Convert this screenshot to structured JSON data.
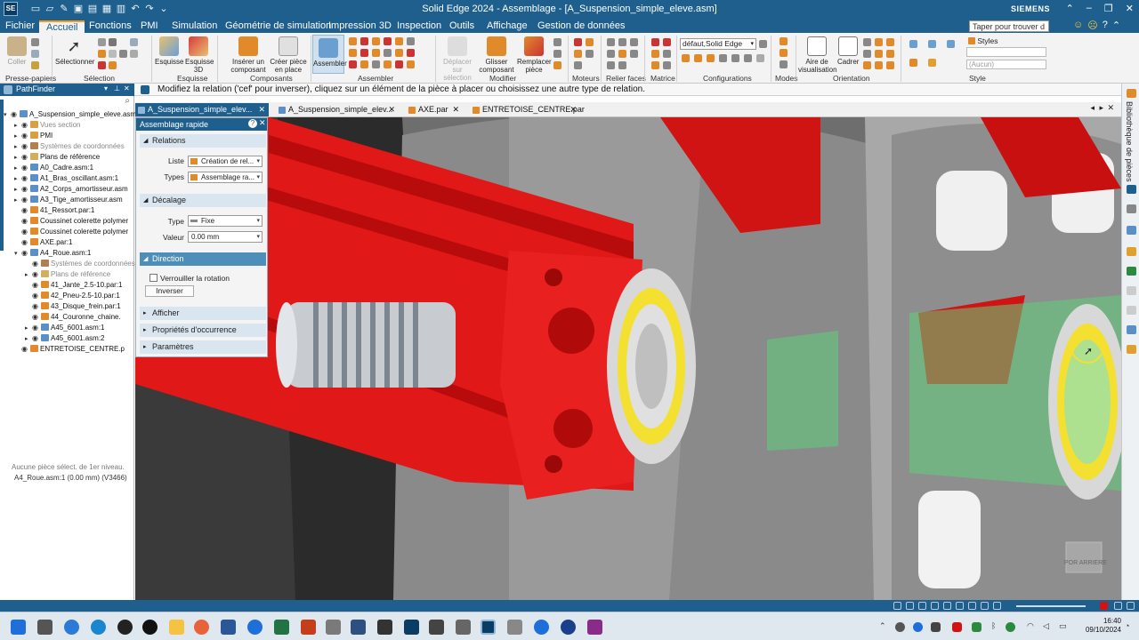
{
  "titlebar": {
    "app_logo": "SE",
    "title": "Solid Edge 2024 - Assemblage - [A_Suspension_simple_eleve.asm]",
    "brand": "SIEMENS"
  },
  "menu": {
    "tabs": [
      "Fichier",
      "Accueil",
      "Fonctions",
      "PMI",
      "Simulation",
      "Géométrie de simulation",
      "Impression 3D",
      "Inspection",
      "Outils",
      "Affichage",
      "Gestion de données"
    ],
    "active_tab": "Accueil",
    "search_placeholder": "Taper pour trouver d"
  },
  "ribbon": {
    "buttons": {
      "coller": "Coller",
      "selectionner": "Sélectionner",
      "esquisse": "Esquisse",
      "esquisse3d": "Esquisse 3D",
      "inserer": "Insérer un composant",
      "creer": "Créer pièce en place",
      "assembler": "Assembler",
      "deplacer": "Déplacer sur sélection",
      "glisser": "Glisser composant",
      "remplacer": "Remplacer pièce",
      "aire": "Aire de visualisation",
      "cadrer": "Cadrer"
    },
    "config_value": "défaut,Solid Edge",
    "styles_label": "Styles",
    "style_value": "(Aucun)",
    "groups": {
      "presse": "Presse-papiers",
      "selection": "Sélection",
      "esquisse": "Esquisse",
      "composants": "Composants",
      "assembler": "Assembler",
      "modifier": "Modifier",
      "moteurs": "Moteurs",
      "relier": "Relier faces",
      "matrice": "Matrice",
      "configurations": "Configurations",
      "modes": "Modes",
      "orientation": "Orientation",
      "style": "Style"
    }
  },
  "prompt": {
    "pathfinder_title": "PathFinder",
    "message": "Modifiez la relation ('cef' pour inverser), cliquez sur un élément de la pièce à placer ou choisissez une autre type de relation."
  },
  "tree": [
    {
      "label": "A_Suspension_simple_eleve.asm",
      "level": 0,
      "exp": "▾",
      "color": "#5b8fc7",
      "dim": false
    },
    {
      "label": "Vues section",
      "level": 1,
      "exp": "▸",
      "color": "#d8a040",
      "dim": true
    },
    {
      "label": "PMI",
      "level": 1,
      "exp": "▸",
      "color": "#d8a040",
      "dim": false
    },
    {
      "label": "Systèmes de coordonnées",
      "level": 1,
      "exp": "▸",
      "color": "#b08050",
      "dim": true
    },
    {
      "label": "Plans de référence",
      "level": 1,
      "exp": "▸",
      "color": "#d0b060",
      "dim": false
    },
    {
      "label": "A0_Cadre.asm:1",
      "level": 1,
      "exp": "▸",
      "color": "#5b8fc7",
      "dim": false
    },
    {
      "label": "A1_Bras_oscillant.asm:1",
      "level": 1,
      "exp": "▸",
      "color": "#5b8fc7",
      "dim": false
    },
    {
      "label": "A2_Corps_amortisseur.asm",
      "level": 1,
      "exp": "▸",
      "color": "#5b8fc7",
      "dim": false
    },
    {
      "label": "A3_Tige_amortisseur.asm",
      "level": 1,
      "exp": "▸",
      "color": "#5b8fc7",
      "dim": false
    },
    {
      "label": "41_Ressort.par:1",
      "level": 1,
      "exp": "",
      "color": "#e08a2a",
      "dim": false
    },
    {
      "label": "Coussinet colerette polymer",
      "level": 1,
      "exp": "",
      "color": "#e08a2a",
      "dim": false
    },
    {
      "label": "Coussinet colerette polymer",
      "level": 1,
      "exp": "",
      "color": "#e08a2a",
      "dim": false
    },
    {
      "label": "AXE.par:1",
      "level": 1,
      "exp": "",
      "color": "#e08a2a",
      "dim": false
    },
    {
      "label": "A4_Roue.asm:1",
      "level": 1,
      "exp": "▾",
      "color": "#5b8fc7",
      "dim": false
    },
    {
      "label": "Systèmes de coordonnées",
      "level": 2,
      "exp": "",
      "color": "#b08050",
      "dim": true
    },
    {
      "label": "Plans de référence",
      "level": 2,
      "exp": "▸",
      "color": "#d0b060",
      "dim": true
    },
    {
      "label": "41_Jante_2.5-10.par:1",
      "level": 2,
      "exp": "",
      "color": "#e08a2a",
      "dim": false
    },
    {
      "label": "42_Pneu-2.5-10.par:1",
      "level": 2,
      "exp": "",
      "color": "#e08a2a",
      "dim": false
    },
    {
      "label": "43_Disque_frein.par:1",
      "level": 2,
      "exp": "",
      "color": "#e08a2a",
      "dim": false
    },
    {
      "label": "44_Couronne_chaine.",
      "level": 2,
      "exp": "",
      "color": "#e08a2a",
      "dim": false
    },
    {
      "label": "A45_6001.asm:1",
      "level": 2,
      "exp": "▸",
      "color": "#5b8fc7",
      "dim": false
    },
    {
      "label": "A45_6001.asm:2",
      "level": 2,
      "exp": "▸",
      "color": "#5b8fc7",
      "dim": false
    },
    {
      "label": "ENTRETOISE_CENTRE.p",
      "level": 1,
      "exp": "",
      "color": "#e08a2a",
      "dim": false
    }
  ],
  "pathfinder_status": {
    "line1": "Aucune pièce sélect. de 1er niveau.",
    "line2": "A4_Roue.asm:1   (0.00 mm)   (V3466)"
  },
  "doc_tabs": [
    {
      "label": "A_Suspension_simple_elev...",
      "active": true
    },
    {
      "label": "A_Suspension_simple_elev...",
      "active": false
    },
    {
      "label": "AXE.par",
      "active": false
    },
    {
      "label": "ENTRETOISE_CENTRE.par",
      "active": false
    }
  ],
  "quick_panel": {
    "title": "Assemblage rapide",
    "sec_relations": "Relations",
    "liste_label": "Liste",
    "liste_value": "Création de rel...",
    "types_label": "Types",
    "types_value": "Assemblage ra...",
    "sec_decalage": "Décalage",
    "type_label": "Type",
    "type_value": "Fixe",
    "valeur_label": "Valeur",
    "valeur_value": "0.00 mm",
    "sec_direction": "Direction",
    "verrouiller": "Verrouiller la rotation",
    "inverser": "Inverser",
    "sec_afficher": "Afficher",
    "sec_proprietes": "Propriétés d'occurrence",
    "sec_parametres": "Paramètres"
  },
  "viewcube": "POR ARRIERE",
  "rightbar_label": "Bibliothèque de pièces",
  "taskbar": {
    "time": "16:40",
    "date": "09/10/2024"
  }
}
